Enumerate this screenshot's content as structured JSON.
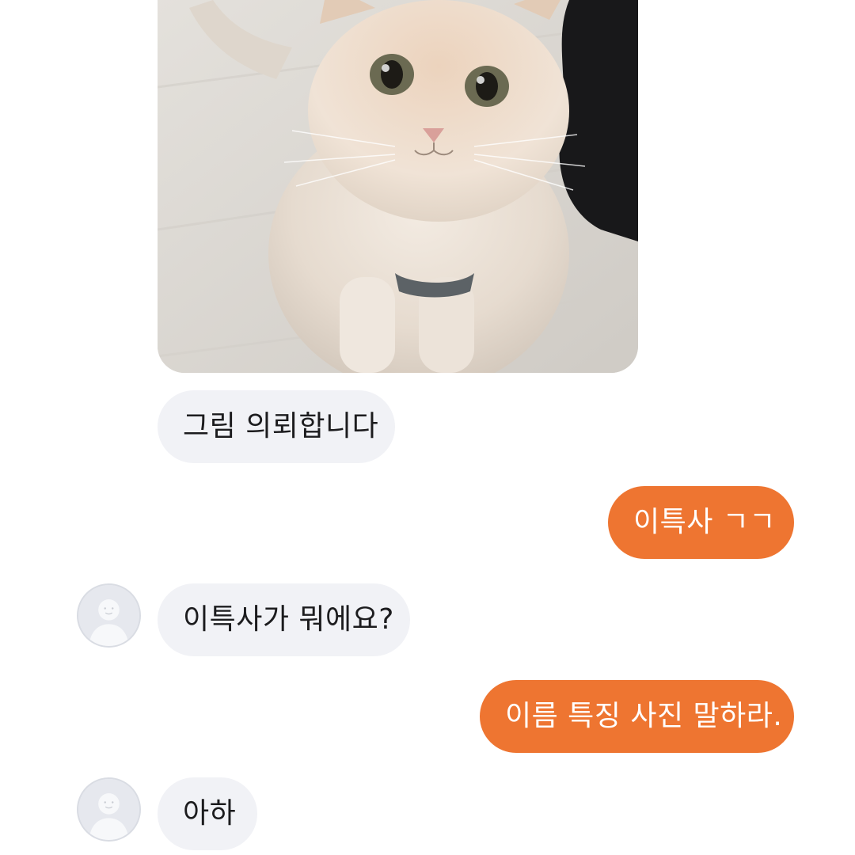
{
  "messages": {
    "photo": {
      "content": "cat photo",
      "icon": "cat-photo"
    },
    "m1": {
      "side": "incoming",
      "text": "그림 의뢰합니다"
    },
    "m2": {
      "side": "outgoing",
      "text": "이특사 ㄱㄱ"
    },
    "m3": {
      "side": "incoming",
      "text": "이특사가 뭐에요?"
    },
    "m4": {
      "side": "outgoing",
      "text": "이름 특징 사진 말하라."
    },
    "m5": {
      "side": "incoming",
      "text": "아하"
    }
  },
  "avatar": {
    "icon": "default-user-avatar-icon"
  },
  "colors": {
    "incoming_bubble": "#f1f2f6",
    "outgoing_bubble": "#ee7531",
    "incoming_text": "#1c1c1e",
    "outgoing_text": "#ffffff",
    "background": "#ffffff"
  }
}
